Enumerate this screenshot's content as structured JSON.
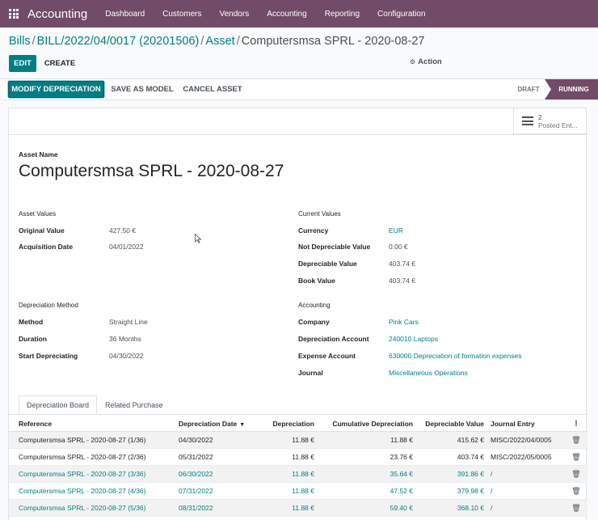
{
  "app": {
    "name": "Accounting",
    "menu": [
      "Dashboard",
      "Customers",
      "Vendors",
      "Accounting",
      "Reporting",
      "Configuration"
    ]
  },
  "breadcrumb": {
    "items": [
      "Bills",
      "BILL/2022/04/0017 (20201506)",
      "Asset"
    ],
    "current": "Computersmsa SPRL - 2020-08-27"
  },
  "control": {
    "edit": "Edit",
    "create": "Create",
    "action": "Action"
  },
  "header": {
    "buttons": [
      "Modify Depreciation",
      "Save as Model",
      "Cancel Asset"
    ],
    "statuses": [
      "Draft",
      "Running"
    ],
    "active_status": "Running"
  },
  "smart_button": {
    "count": "2",
    "label": "Posted Ent..."
  },
  "form": {
    "asset_name_label": "Asset Name",
    "asset_name": "Computersmsa SPRL - 2020-08-27",
    "asset_values": {
      "title": "Asset Values",
      "fields": [
        {
          "label": "Original Value",
          "value": "427.50 €"
        },
        {
          "label": "Acquisition Date",
          "value": "04/01/2022"
        }
      ]
    },
    "current_values": {
      "title": "Current Values",
      "fields": [
        {
          "label": "Currency",
          "value": "EUR"
        },
        {
          "label": "Not Depreciable Value",
          "value": "0.00 €"
        },
        {
          "label": "Depreciable Value",
          "value": "403.74 €"
        },
        {
          "label": "Book Value",
          "value": "403.74 €"
        }
      ]
    },
    "depreciation_method": {
      "title": "Depreciation Method",
      "fields": [
        {
          "label": "Method",
          "value": "Straight Line"
        },
        {
          "label": "Duration",
          "value": "36",
          "unit": "Months"
        },
        {
          "label": "Start Depreciating",
          "value": "04/30/2022"
        }
      ]
    },
    "accounting": {
      "title": "Accounting",
      "fields": [
        {
          "label": "Company",
          "value": "Pink Cars"
        },
        {
          "label": "Depreciation Account",
          "value": "240010 Laptops"
        },
        {
          "label": "Expense Account",
          "value": "630000 Depreciation of formation expenses"
        },
        {
          "label": "Journal",
          "value": "Miscellaneous Operations"
        }
      ]
    }
  },
  "tabs": [
    "Depreciation Board",
    "Related Purchase"
  ],
  "table": {
    "columns": [
      "Reference",
      "Depreciation Date",
      "Depreciation",
      "Cumulative Depreciation",
      "Depreciable Value",
      "Journal Entry"
    ],
    "rows": [
      {
        "ref": "Computersmsa SPRL - 2020-08-27 (1/36)",
        "date": "04/30/2022",
        "dep": "11.88 €",
        "cum": "11.88 €",
        "val": "415.62 €",
        "je": "MISC/2022/04/0005"
      },
      {
        "ref": "Computersmsa SPRL - 2020-08-27 (2/36)",
        "date": "05/31/2022",
        "dep": "11.88 €",
        "cum": "23.76 €",
        "val": "403.74 €",
        "je": "MISC/2022/05/0005"
      },
      {
        "ref": "Computersmsa SPRL - 2020-08-27 (3/36)",
        "date": "06/30/2022",
        "dep": "11.88 €",
        "cum": "35.64 €",
        "val": "391.86 €",
        "je": "/"
      },
      {
        "ref": "Computersmsa SPRL - 2020-08-27 (4/36)",
        "date": "07/31/2022",
        "dep": "11.88 €",
        "cum": "47.52 €",
        "val": "379.98 €",
        "je": "/"
      },
      {
        "ref": "Computersmsa SPRL - 2020-08-27 (5/36)",
        "date": "08/31/2022",
        "dep": "11.88 €",
        "cum": "59.40 €",
        "val": "368.10 €",
        "je": "/"
      }
    ]
  },
  "colors": {
    "brand": "#714b67",
    "accent": "#017e84"
  }
}
